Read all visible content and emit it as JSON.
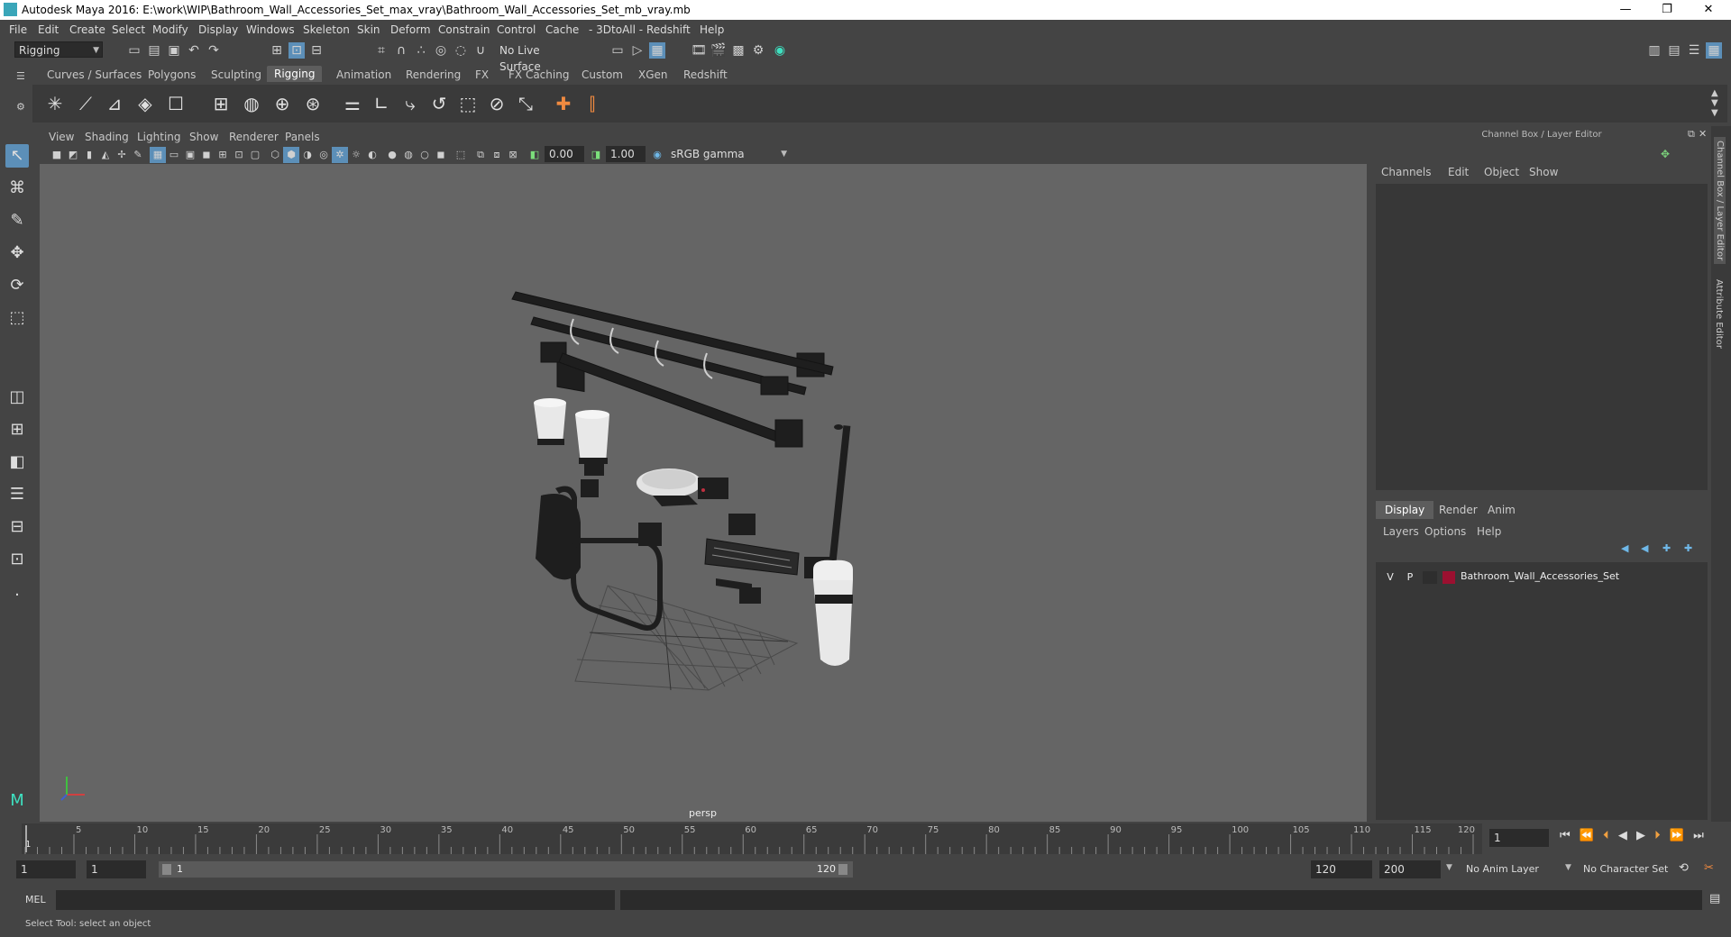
{
  "window": {
    "title": "Autodesk Maya 2016: E:\\work\\WIP\\Bathroom_Wall_Accessories_Set_max_vray\\Bathroom_Wall_Accessories_Set_mb_vray.mb",
    "minimize": "—",
    "restore": "❐",
    "close": "✕"
  },
  "menubar": [
    "File",
    "Edit",
    "Create",
    "Select",
    "Modify",
    "Display",
    "Windows",
    "Skeleton",
    "Skin",
    "Deform",
    "Constrain",
    "Control",
    "Cache",
    "- 3DtoAll -",
    "Redshift",
    "Help"
  ],
  "statusline": {
    "mode": "Rigging",
    "live_surface": "No Live Surface"
  },
  "shelf": {
    "tabs": [
      "Curves / Surfaces",
      "Polygons",
      "Sculpting",
      "Rigging",
      "Animation",
      "Rendering",
      "FX",
      "FX Caching",
      "Custom",
      "XGen",
      "Redshift"
    ],
    "active_tab": "Rigging"
  },
  "viewport": {
    "menu": [
      "View",
      "Shading",
      "Lighting",
      "Show",
      "Renderer",
      "Panels"
    ],
    "exposure": "0.00",
    "gamma": "1.00",
    "color_space": "sRGB gamma",
    "camera_label": "persp"
  },
  "channelbox": {
    "title": "Channel Box / Layer Editor",
    "menu": [
      "Channels",
      "Edit",
      "Object",
      "Show"
    ],
    "layer_tabs": [
      "Display",
      "Render",
      "Anim"
    ],
    "active_layer_tab": "Display",
    "layer_menu": [
      "Layers",
      "Options",
      "Help"
    ],
    "layer": {
      "v": "V",
      "p": "P",
      "name": "Bathroom_Wall_Accessories_Set",
      "color": "#9b1030"
    },
    "side_tabs": [
      "Channel Box / Layer Editor",
      "Attribute Editor"
    ]
  },
  "timeline": {
    "ticks": [
      "5",
      "10",
      "15",
      "20",
      "25",
      "30",
      "35",
      "40",
      "45",
      "50",
      "55",
      "60",
      "65",
      "70",
      "75",
      "80",
      "85",
      "90",
      "95",
      "100",
      "105",
      "110",
      "115",
      "120"
    ],
    "start_marker": "1",
    "current_frame": "1"
  },
  "range": {
    "start": "1",
    "playback_start": "1",
    "slider_start": "1",
    "slider_end": "120",
    "playback_end": "120",
    "end": "200",
    "anim_layer": "No Anim Layer",
    "character_set": "No Character Set"
  },
  "cmdline": {
    "label": "MEL"
  },
  "helpline": {
    "text": "Select Tool: select an object"
  },
  "colors": {
    "accent": "#5c8fb8",
    "viewport_bg": "#656565",
    "panel": "#373737"
  }
}
